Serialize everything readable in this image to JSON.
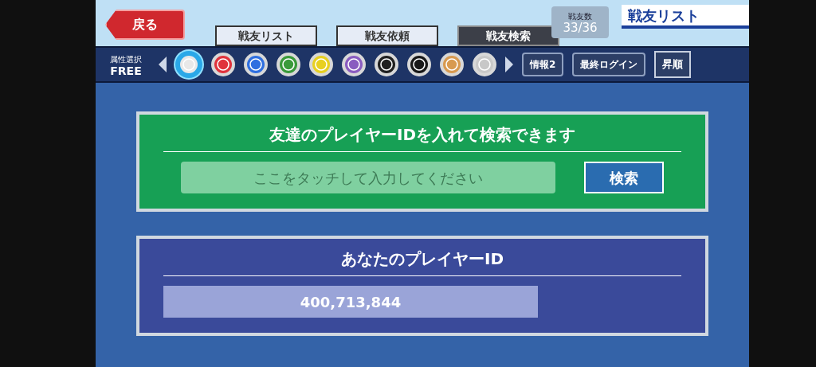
{
  "header": {
    "back_button": "戻る",
    "title": "戦友リスト",
    "friend_count": {
      "label": "戦友数",
      "value": "33/36"
    }
  },
  "tabs": [
    {
      "label": "戦友リスト",
      "selected": false
    },
    {
      "label": "戦友依頼",
      "selected": false
    },
    {
      "label": "戦友検索",
      "selected": true
    }
  ],
  "filter": {
    "label": "属性選択",
    "value": "FREE",
    "attributes": [
      {
        "color": "#e8e8e8",
        "selected": true
      },
      {
        "color": "#e0323c",
        "selected": false
      },
      {
        "color": "#2f6fe0",
        "selected": false
      },
      {
        "color": "#3a9a3a",
        "selected": false
      },
      {
        "color": "#e8d020",
        "selected": false
      },
      {
        "color": "#8a5cc0",
        "selected": false
      },
      {
        "color": "#202020",
        "selected": false
      },
      {
        "color": "#181818",
        "selected": false
      },
      {
        "color": "#d89a50",
        "selected": false
      },
      {
        "color": "#c8c8c8",
        "selected": false
      }
    ],
    "buttons": [
      "情報2",
      "最終ログイン"
    ],
    "sort_button": "昇順"
  },
  "search_panel": {
    "title": "友達のプレイヤーIDを入れて検索できます",
    "placeholder": "ここをタッチして入力してください",
    "button": "検索"
  },
  "id_panel": {
    "title": "あなたのプレイヤーID",
    "value": "400,713,844"
  }
}
